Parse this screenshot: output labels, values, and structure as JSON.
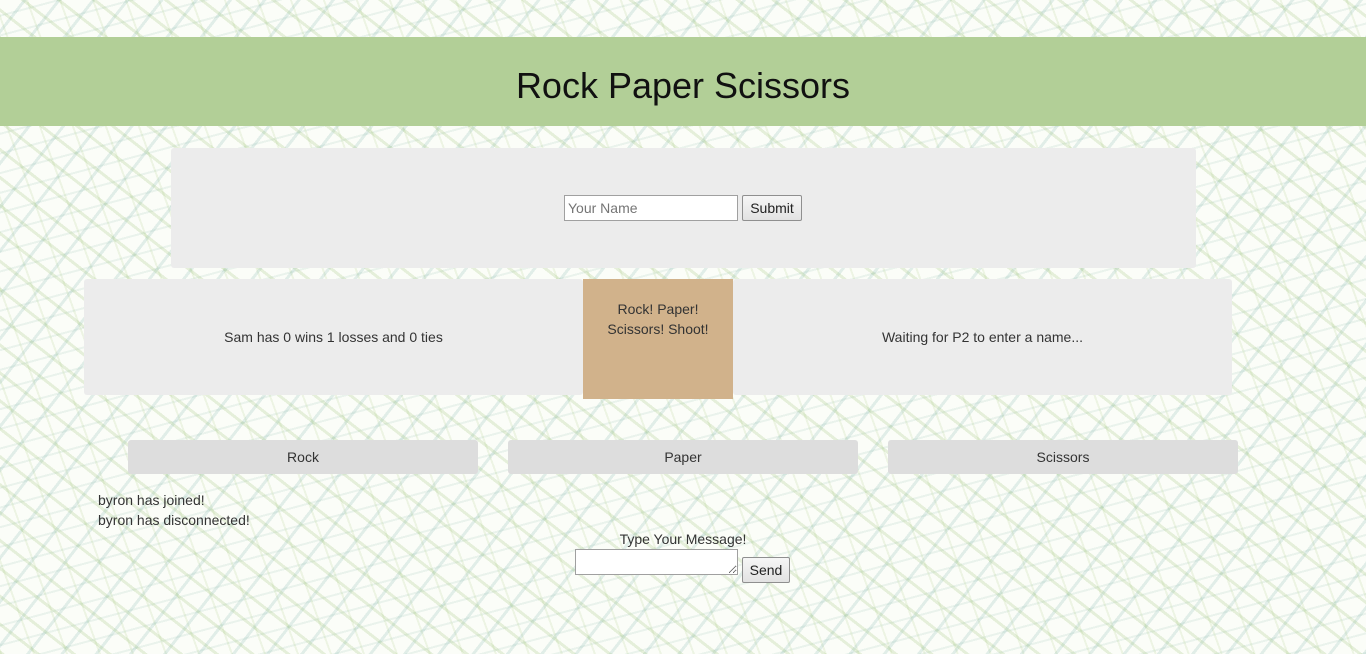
{
  "header": {
    "title": "Rock Paper Scissors"
  },
  "name_form": {
    "placeholder": "Your Name",
    "value": "",
    "submit_label": "Submit"
  },
  "player1": {
    "status": "Sam has 0 wins 1 losses and 0 ties"
  },
  "center_box": {
    "line1": "Rock! Paper!",
    "line2": "Scissors! Shoot!"
  },
  "player2": {
    "status": "Waiting for P2 to enter a name..."
  },
  "choices": [
    {
      "label": "Rock"
    },
    {
      "label": "Paper"
    },
    {
      "label": "Scissors"
    }
  ],
  "chat": {
    "messages": [
      "byron has joined!",
      "byron has disconnected!"
    ],
    "label": "Type Your Message!",
    "send_label": "Send"
  },
  "colors": {
    "header_bg": "#b2cf97",
    "panel_bg": "#ececec",
    "center_box_bg": "#d1b28b",
    "choice_bg": "#dddddd"
  }
}
